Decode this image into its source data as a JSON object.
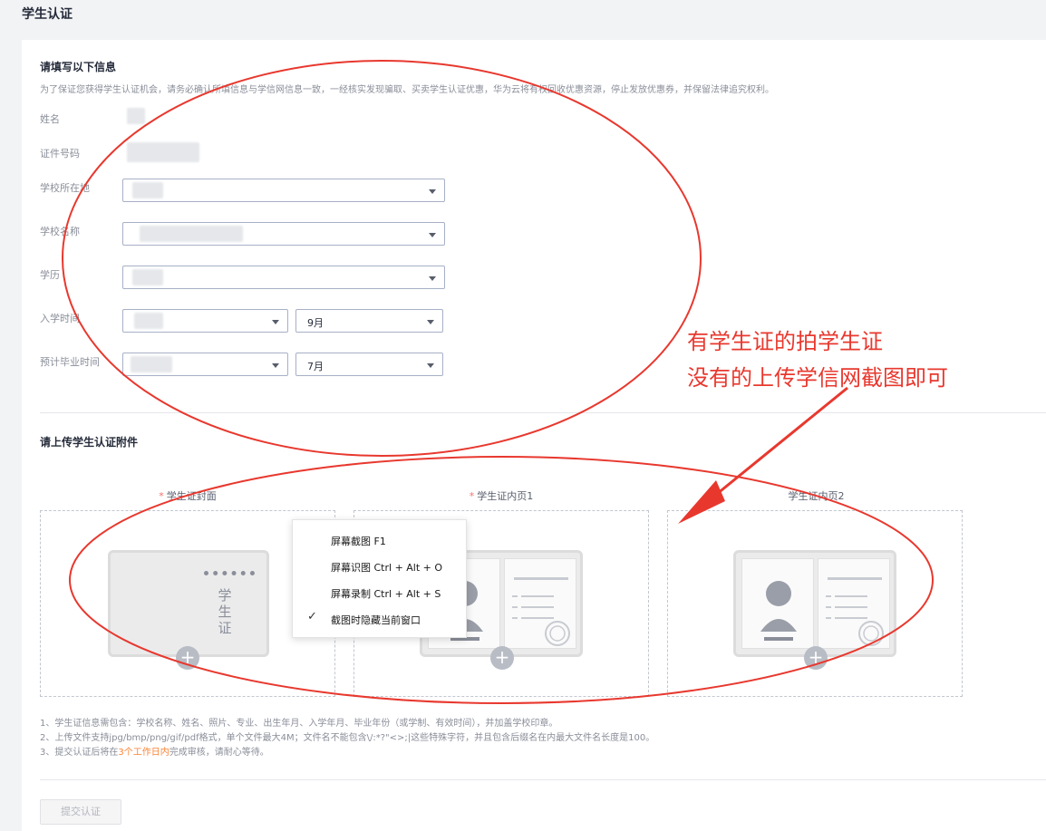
{
  "page": {
    "title": "学生认证"
  },
  "info": {
    "section_title": "请填写以下信息",
    "notice": "为了保证您获得学生认证机会，请务必确认所填信息与学信网信息一致，一经核实发现骗取、买卖学生认证优惠，华为云将有权回收优惠资源，停止发放优惠券，并保留法律追究权利。",
    "fields": {
      "name_label": "姓名",
      "id_label": "证件号码",
      "school_location_label": "学校所在地",
      "school_name_label": "学校名称",
      "education_label": "学历",
      "enroll_time_label": "入学时间",
      "enroll_month": "9月",
      "graduate_time_label": "预计毕业时间",
      "graduate_month": "7月"
    }
  },
  "upload": {
    "section_title": "请上传学生认证附件",
    "slots": [
      {
        "label": "学生证封面",
        "required": "*",
        "card_text": "学生证"
      },
      {
        "label": "学生证内页1",
        "required": "*"
      },
      {
        "label": "学生证内页2",
        "required": ""
      }
    ]
  },
  "context_menu": {
    "items": [
      "屏幕截图 F1",
      "屏幕识图 Ctrl + Alt + O",
      "屏幕录制 Ctrl + Alt + S",
      "截图时隐藏当前窗口"
    ],
    "checked_item": "截图时隐藏当前窗口"
  },
  "tips": {
    "line1": "1、学生证信息需包含：学校名称、姓名、照片、专业、出生年月、入学年月、毕业年份（或学制、有效时间），并加盖学校印章。",
    "line2": "2、上传文件支持jpg/bmp/png/gif/pdf格式，单个文件最大4M；文件名不能包含\\/:*?\"<>;|这些特殊字符，并且包含后缀名在内最大文件名长度是100。",
    "line3_prefix": "3、提交认证后将在",
    "line3_highlight": "3个工作日内",
    "line3_suffix": "完成审核，请耐心等待。"
  },
  "submit_label": "提交认证",
  "annotation": {
    "line1": "有学生证的拍学生证",
    "line2": "没有的上传学信网截图即可",
    "color": "#e8382e"
  }
}
